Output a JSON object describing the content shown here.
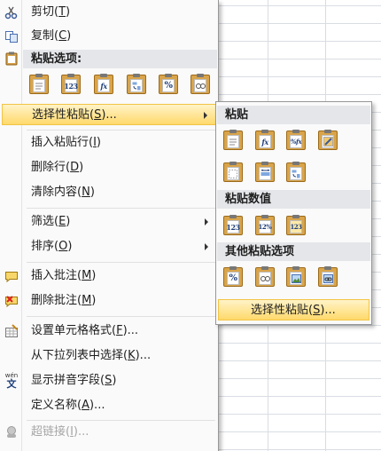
{
  "menu": {
    "cut": {
      "label": "剪切(T)",
      "text": "剪切(",
      "key": "T",
      "end": ")"
    },
    "copy": {
      "label": "复制(C)",
      "text": "复制(",
      "key": "C",
      "end": ")"
    },
    "paste_options_header": "粘贴选项:",
    "paste_options": [
      "paste",
      "values-123",
      "formulas-fx",
      "transpose",
      "formatting-percent",
      "paste-link"
    ],
    "paste_special": {
      "text": "选择性粘贴(",
      "key": "S",
      "end": ")..."
    },
    "insert_pasted_rows": {
      "text": "插入粘贴行(",
      "key": "I",
      "end": ")"
    },
    "delete_row": {
      "text": "删除行(",
      "key": "D",
      "end": ")"
    },
    "clear_contents": {
      "text": "清除内容(",
      "key": "N",
      "end": ")"
    },
    "filter": {
      "text": "筛选(",
      "key": "E",
      "end": ")"
    },
    "sort": {
      "text": "排序(",
      "key": "O",
      "end": ")"
    },
    "insert_comment": {
      "text": "插入批注(",
      "key": "M",
      "end": ")"
    },
    "delete_comment": {
      "text": "删除批注(",
      "key": "M",
      "end": ")"
    },
    "format_cells": {
      "text": "设置单元格格式(",
      "key": "F",
      "end": ")..."
    },
    "pick_from_list": {
      "text": "从下拉列表中选择(",
      "key": "K",
      "end": ")..."
    },
    "show_phonetic": {
      "text": "显示拼音字段(",
      "key": "S",
      "end": ")"
    },
    "define_name": {
      "text": "定义名称(",
      "key": "A",
      "end": ")..."
    },
    "hyperlink": {
      "text": "超链接(",
      "key": "I",
      "end": ")...",
      "disabled": true
    }
  },
  "submenu": {
    "paste_header": "粘贴",
    "paste_values_header": "粘贴数值",
    "other_paste_header": "其他粘贴选项",
    "paste_special": {
      "text": "选择性粘贴(",
      "key": "S",
      "end": ")..."
    }
  },
  "icon_text": {
    "fx": "fx",
    "n123": "123",
    "pct": "%",
    "n12": "12",
    "wen": "wén",
    "wen_char": "文"
  },
  "colors": {
    "highlight": "#ffd96b",
    "header_bg": "#e4e6e9",
    "clipboard": "#d9a44a"
  }
}
